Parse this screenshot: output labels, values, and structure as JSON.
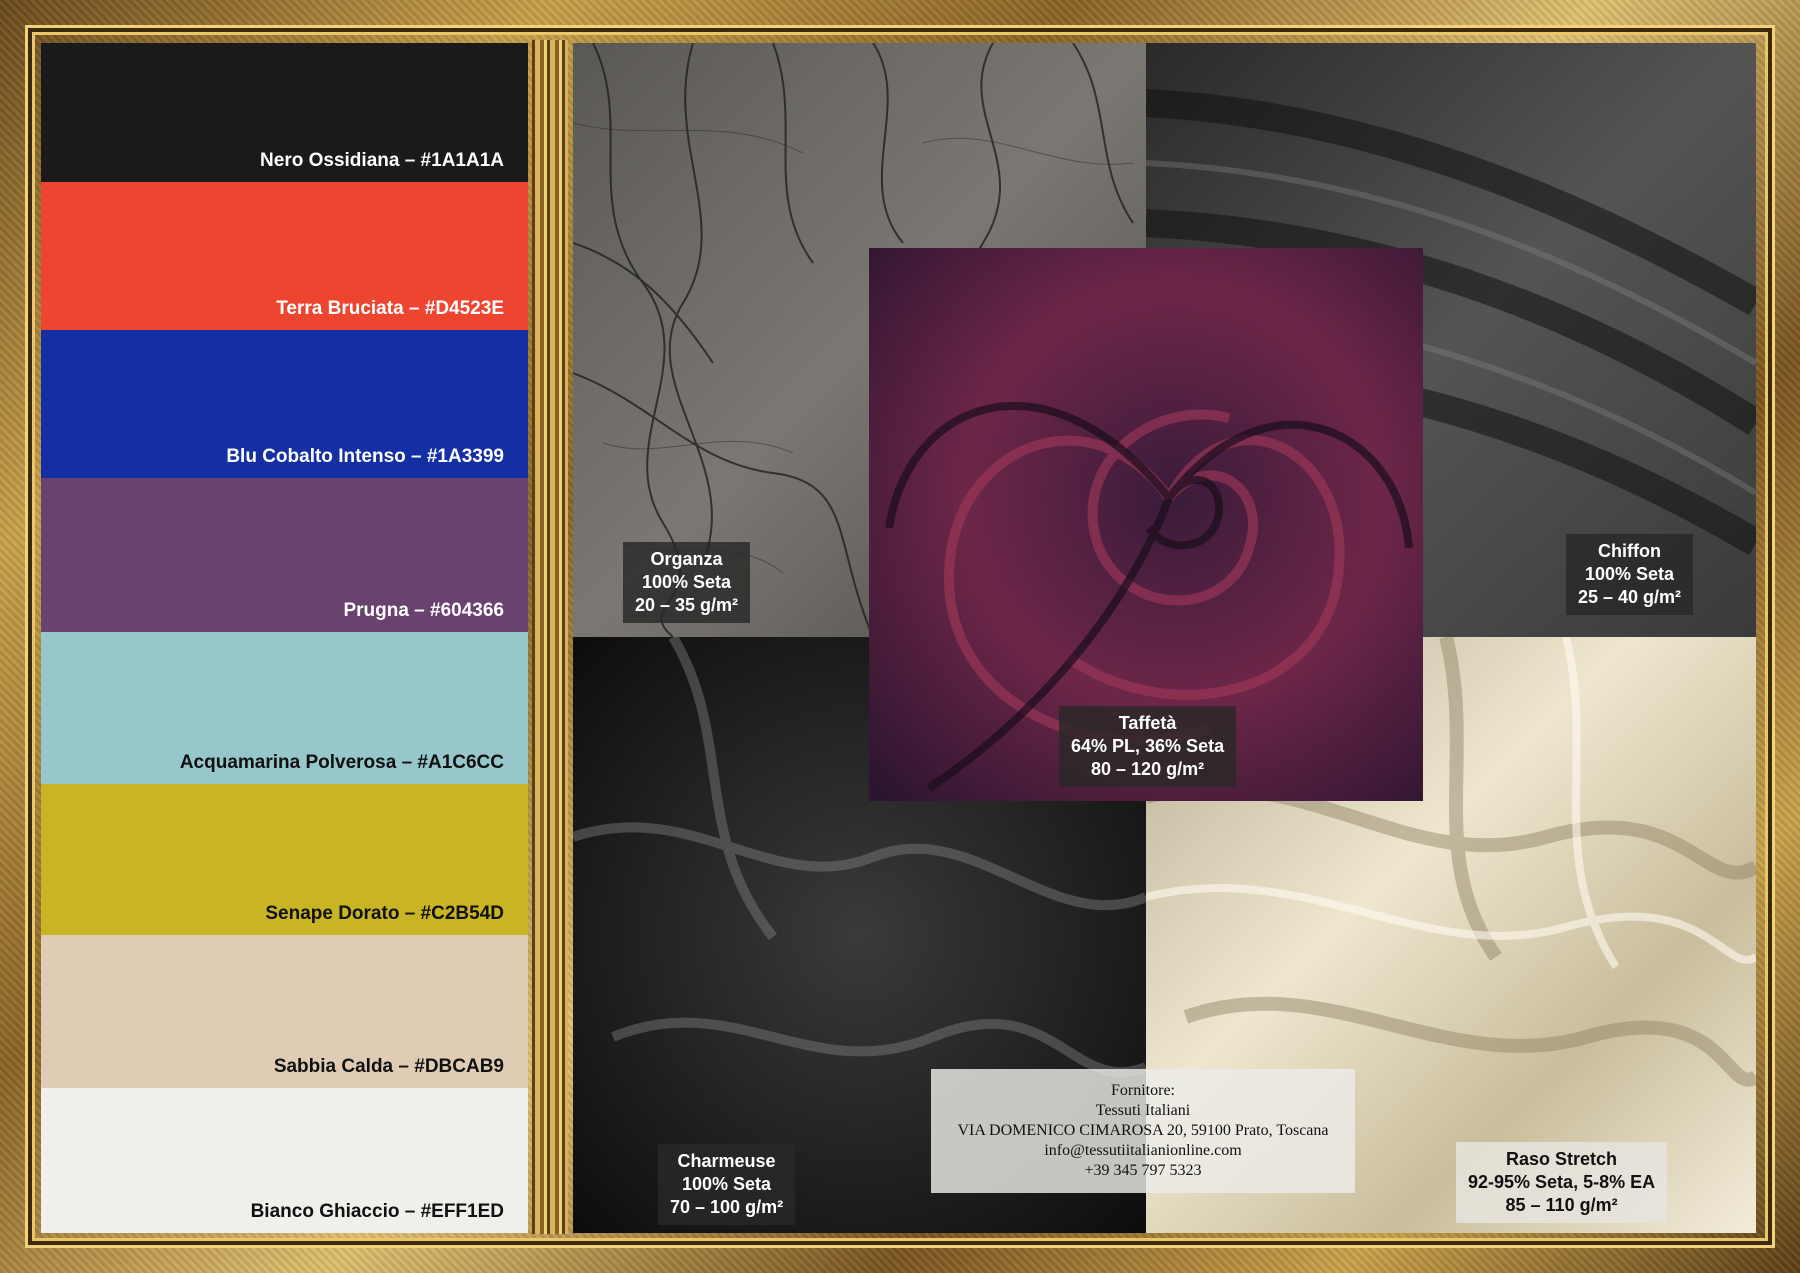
{
  "palette": [
    {
      "name": "Nero Ossidiana – #1A1A1A",
      "color": "#1A1A1A",
      "text_color": "#FFFFFF"
    },
    {
      "name": "Terra Bruciata – #D4523E",
      "color": "#EE4531",
      "text_color": "#FFFFFF"
    },
    {
      "name": "Blu Cobalto Intenso – #1A3399",
      "color": "#132FA3",
      "text_color": "#FFFFFF"
    },
    {
      "name": "Prugna – #604366",
      "color": "#69426F",
      "text_color": "#FFFFFF"
    },
    {
      "name": "Acquamarina Polverosa – #A1C6CC",
      "color": "#97C6CB",
      "text_color": "#111111"
    },
    {
      "name": "Senape Dorato – #C2B54D",
      "color": "#C9B424",
      "text_color": "#111111"
    },
    {
      "name": "Sabbia Calda – #DBCAB9",
      "color": "#E0CCB5",
      "text_color": "#111111"
    },
    {
      "name": "Bianco Ghiaccio – #EFF1ED",
      "color": "#EFF0EC",
      "text_color": "#111111"
    }
  ],
  "fabrics": {
    "organza": {
      "name": "Organza",
      "composition": "100% Seta",
      "weight": "20 – 35 g/m²"
    },
    "chiffon": {
      "name": "Chiffon",
      "composition": "100% Seta",
      "weight": "25 – 40 g/m²"
    },
    "taffeta": {
      "name": "Taffetà",
      "composition": "64% PL, 36% Seta",
      "weight": "80 – 120 g/m²"
    },
    "charmeuse": {
      "name": "Charmeuse",
      "composition": "100% Seta",
      "weight": "70 – 100 g/m²"
    },
    "raso": {
      "name": "Raso Stretch",
      "composition": "92-95% Seta, 5-8% EA",
      "weight": "85 – 110 g/m²"
    }
  },
  "supplier": {
    "heading": "Fornitore:",
    "company": "Tessuti Italiani",
    "address": "VIA DOMENICO CIMAROSA 20, 59100 Prato, Toscana",
    "email": "info@tessutiitalianionline.com",
    "phone": "+39 345 797 5323"
  }
}
